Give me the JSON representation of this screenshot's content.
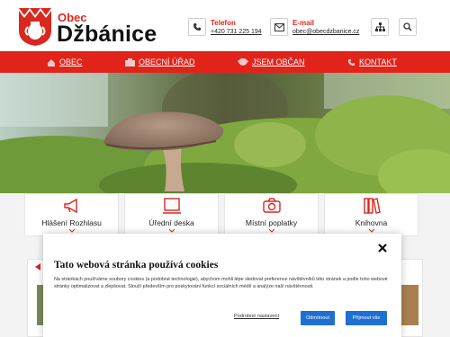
{
  "header": {
    "site_prefix": "Obec",
    "site_name": "Džbánice",
    "phone_label": "Telefon",
    "phone_value": "+420 731 225 194",
    "email_label": "E-mail",
    "email_value": "obec@obecdzbanice.cz",
    "icons": [
      "phone-icon",
      "mail-icon",
      "sitemap-icon",
      "search-icon"
    ]
  },
  "nav": {
    "items": [
      {
        "label": "OBEC",
        "icon": "home-icon"
      },
      {
        "label": "OBECNÍ ÚŘAD",
        "icon": "office-icon"
      },
      {
        "label": "JSEM OBČAN",
        "icon": "handshake-icon"
      },
      {
        "label": "KONTAKT",
        "icon": "phone-icon"
      }
    ]
  },
  "tiles": [
    {
      "label": "Hlášení Rozhlasu",
      "icon": "megaphone-icon"
    },
    {
      "label": "Úřední deska",
      "icon": "board-icon"
    },
    {
      "label": "Místní poplatky",
      "icon": "camera-icon"
    },
    {
      "label": "Knihovna",
      "icon": "books-icon"
    }
  ],
  "cookie": {
    "title": "Tato webová stránka používá cookies",
    "text": "Na stránkách používáme soubory cookies (a podobné technologie), abychom mohli lépe sledovat preference návštěvníků této stránek a podle toho webové stránky optimalizovat a zlepšovat. Slouží především pro poskytování funkcí sociálních médií a analýze naší návštěvnosti.",
    "settings_label": "Podrobné nastavení",
    "reject_label": "Odmítnout",
    "accept_label": "Přijmout vše"
  },
  "colors": {
    "brand_red": "#e2231a",
    "button_blue": "#1d6fd1"
  }
}
